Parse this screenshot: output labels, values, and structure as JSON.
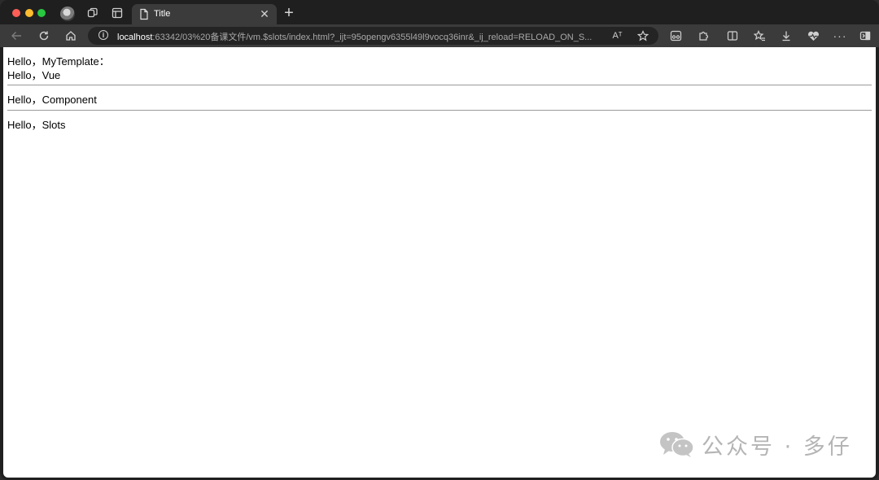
{
  "tab": {
    "title": "Title"
  },
  "address_bar": {
    "host": "localhost",
    "path": ":63342/03%20备课文件/vm.$slots/index.html?_ijt=95opengv6355l49l9vocq36inr&_ij_reload=RELOAD_ON_S..."
  },
  "icons": {
    "back": "back-arrow-icon",
    "reload": "reload-icon",
    "home": "home-icon",
    "read_aloud_label": "Aᵀ"
  },
  "page": {
    "lines": [
      "Hello，MyTemplate：",
      "Hello，Vue",
      "Hello，Component",
      "Hello，Slots"
    ]
  },
  "watermark": {
    "text": "公众号 · 多仔"
  },
  "colors": {
    "tabbar": "#1f1f1f",
    "toolbar": "#3b3b3b",
    "address": "#242424",
    "page": "#ffffff"
  }
}
